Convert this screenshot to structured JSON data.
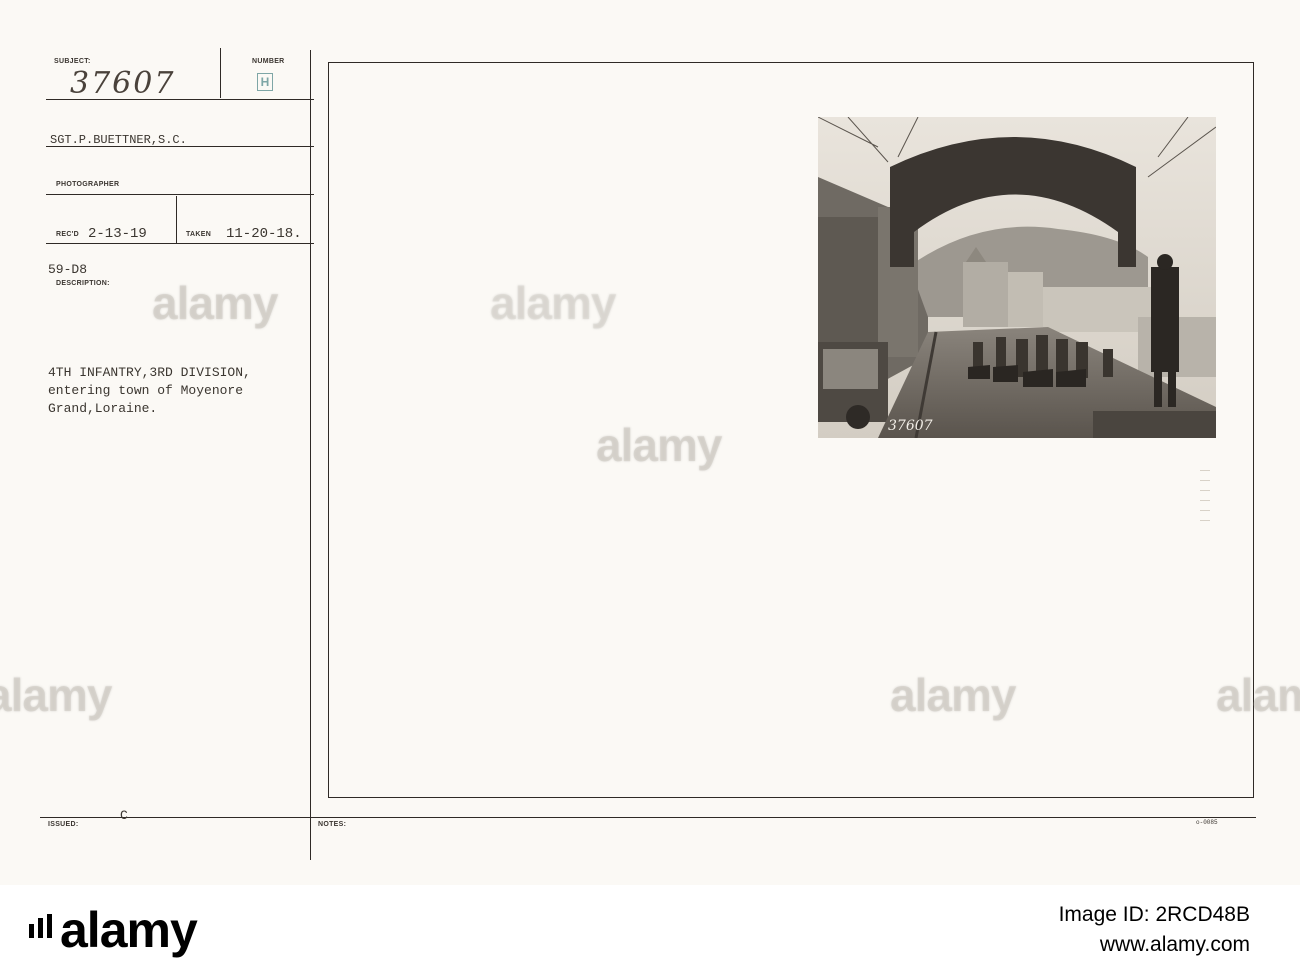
{
  "card": {
    "subject_label": "SUBJECT:",
    "subject_number": "37607",
    "number_label": "NUMBER",
    "number_mark": "H",
    "photographer_name": "SGT.P.BUETTNER,S.C.",
    "photographer_label": "PHOTOGRAPHER",
    "recd_label": "REC'D",
    "recd_date": "2-13-19",
    "taken_label": "TAKEN",
    "taken_date": "11-20-18.",
    "code": "59-D8",
    "description_label": "DESCRIPTION:",
    "description_lines": [
      "4TH INFANTRY,3RD DIVISION,",
      "entering town of Moyenore",
      "Grand,Loraine."
    ],
    "issued_label": "ISSUED:",
    "issued_value": "C",
    "notes_label": "NOTES:",
    "footer_code": "o-0085"
  },
  "photo": {
    "caption_number": "37607"
  },
  "watermark": {
    "text": "alamy"
  },
  "banner": {
    "logo_text": "alamy",
    "image_id_label": "Image ID:",
    "image_id": "2RCD48B",
    "url": "www.alamy.com"
  }
}
